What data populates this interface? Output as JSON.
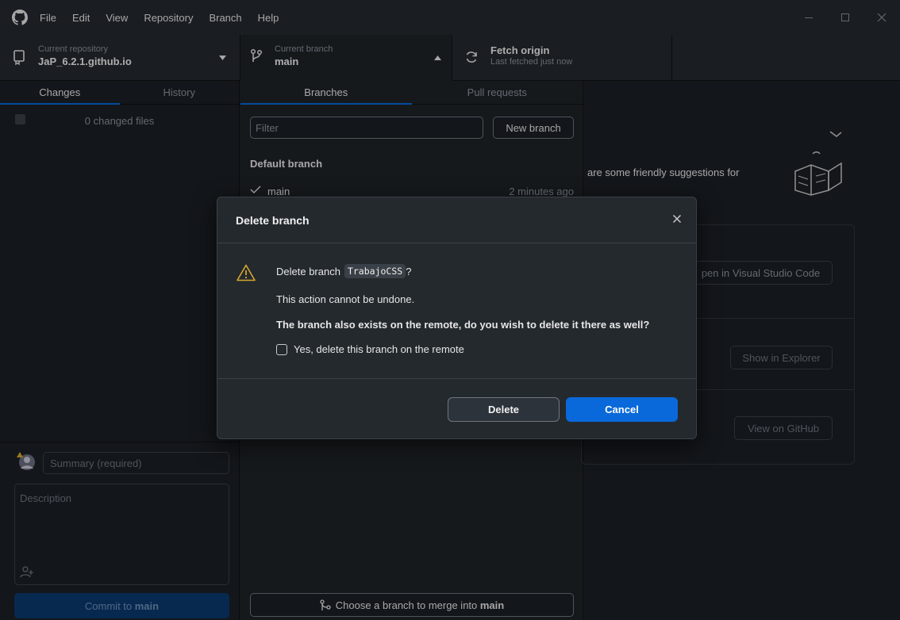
{
  "menu": [
    "File",
    "Edit",
    "View",
    "Repository",
    "Branch",
    "Help"
  ],
  "toolbar": {
    "repo_label": "Current repository",
    "repo_name": "JaP_6.2.1.github.io",
    "branch_label": "Current branch",
    "branch_name": "main",
    "fetch_title": "Fetch origin",
    "fetch_sub": "Last fetched just now"
  },
  "left": {
    "tabs": [
      "Changes",
      "History"
    ],
    "changed_files": "0 changed files",
    "summary_placeholder": "Summary (required)",
    "description_placeholder": "Description",
    "commit_prefix": "Commit to ",
    "commit_branch": "main"
  },
  "branches": {
    "tabs": [
      "Branches",
      "Pull requests"
    ],
    "filter_placeholder": "Filter",
    "new_branch": "New branch",
    "default_heading": "Default branch",
    "default_item": "main",
    "default_time": "2 minutes ago",
    "merge_prefix": "Choose a branch to merge into ",
    "merge_branch": "main"
  },
  "right": {
    "suggestion_text": "are some friendly suggestions for",
    "open_vscode": "Open in Visual Studio Code",
    "open_vscode_visible": "pen in Visual Studio Code",
    "show_explorer": "Show in Explorer",
    "view_github": "View on GitHub"
  },
  "dialog": {
    "title": "Delete branch",
    "question_prefix": "Delete branch",
    "branch": "TrabajoCSS",
    "question_suffix": "?",
    "warning": "This action cannot be undone.",
    "remote_question": "The branch also exists on the remote, do you wish to delete it there as well?",
    "checkbox_label": "Yes, delete this branch on the remote",
    "delete": "Delete",
    "cancel": "Cancel"
  },
  "colors": {
    "accent": "#0969da",
    "warning": "#d4a72c",
    "bg": "#1b1f24"
  }
}
